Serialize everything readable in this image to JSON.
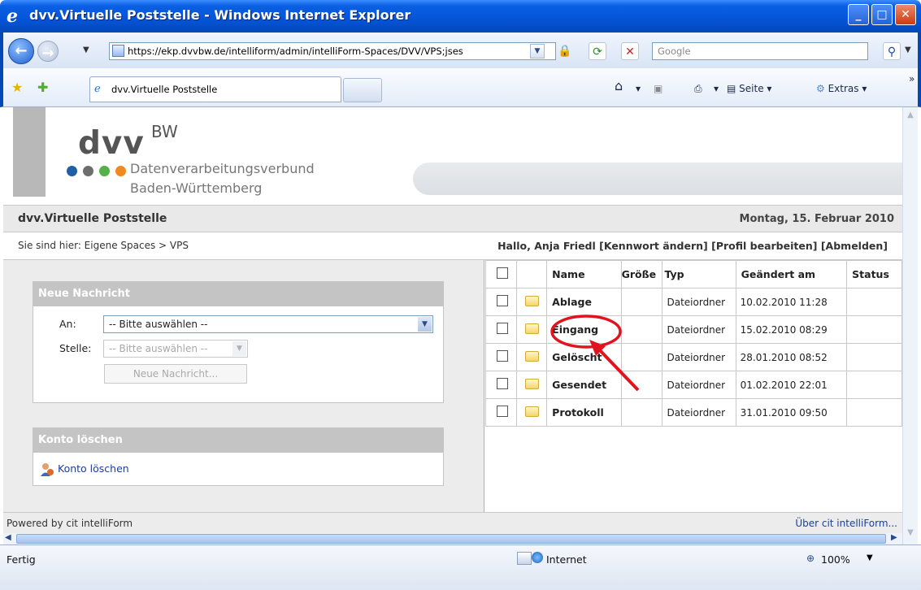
{
  "window": {
    "title": "dvv.Virtuelle Poststelle - Windows Internet Explorer"
  },
  "toolbar": {
    "address": "https://ekp.dvvbw.de/intelliform/admin/intelliForm-Spaces/DVV/VPS;jses",
    "search_placeholder": "Google"
  },
  "tab": {
    "label": "dvv.Virtuelle Poststelle"
  },
  "commands": {
    "page": "Seite",
    "tools": "Extras"
  },
  "logo": {
    "main": "dvv",
    "sup": "BW",
    "line1": "Datenverarbeitungsverbund",
    "line2": "Baden-Württemberg",
    "dot_colors": [
      "#1f5fa6",
      "#6e6e6e",
      "#55b048",
      "#f08a1e"
    ]
  },
  "app": {
    "name": "dvv.Virtuelle Poststelle",
    "date": "Montag, 15. Februar 2010"
  },
  "breadcrumb": "Sie sind hier: Eigene Spaces > VPS",
  "user": {
    "greeting": "Hallo, Anja Friedl",
    "change_pw": "[Kennwort ändern]",
    "edit_profile": "[Profil bearbeiten]",
    "logout": "[Abmelden]"
  },
  "new_message": {
    "header": "Neue Nachricht",
    "to_label": "An:",
    "to_value": "-- Bitte auswählen --",
    "office_label": "Stelle:",
    "office_value": "-- Bitte auswählen --",
    "button": "Neue Nachricht..."
  },
  "delete_account": {
    "header": "Konto löschen",
    "link": "Konto löschen"
  },
  "files": {
    "columns": [
      "Name",
      "Größe",
      "Typ",
      "Geändert am",
      "Status"
    ],
    "rows": [
      {
        "name": "Ablage",
        "size": "",
        "type": "Dateiordner",
        "modified": "10.02.2010 11:28"
      },
      {
        "name": "Eingang",
        "size": "",
        "type": "Dateiordner",
        "modified": "15.02.2010 08:29"
      },
      {
        "name": "Gelöscht",
        "size": "",
        "type": "Dateiordner",
        "modified": "28.01.2010 08:52"
      },
      {
        "name": "Gesendet",
        "size": "",
        "type": "Dateiordner",
        "modified": "01.02.2010 22:01"
      },
      {
        "name": "Protokoll",
        "size": "",
        "type": "Dateiordner",
        "modified": "31.01.2010 09:50"
      }
    ]
  },
  "footer": {
    "powered": "Powered by cit intelliForm",
    "about": "Über cit intelliForm..."
  },
  "status": {
    "text": "Fertig",
    "zone": "Internet",
    "zoom": "100%"
  },
  "annotation_color": "#e0141e"
}
